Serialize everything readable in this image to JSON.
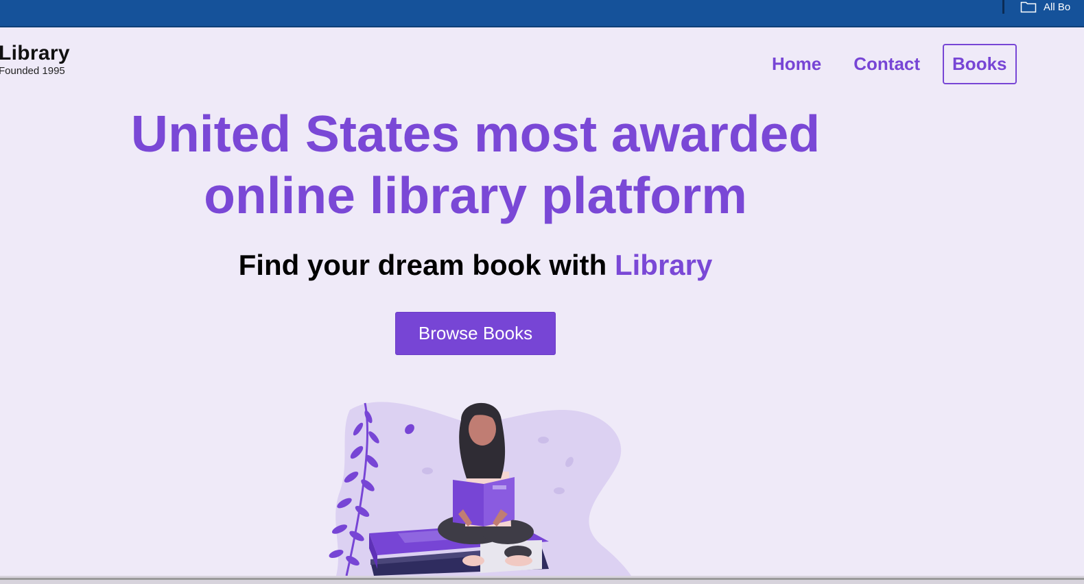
{
  "browser": {
    "bookmark_label": "All Bo"
  },
  "header": {
    "logo_title": "Library",
    "logo_subtitle": "Founded 1995",
    "nav": [
      {
        "label": "Home",
        "active": false
      },
      {
        "label": "Contact",
        "active": false
      },
      {
        "label": "Books",
        "active": true
      }
    ]
  },
  "hero": {
    "title_line1": "United States most awarded",
    "title_line2": "online library platform",
    "subtitle_prefix": "Find your dream book with ",
    "subtitle_accent": "Library",
    "cta_label": "Browse Books"
  },
  "colors": {
    "accent": "#7745d5",
    "topbar": "#15529a",
    "background": "#efeaf8"
  },
  "icons": {
    "bookmark": "folder-icon"
  }
}
